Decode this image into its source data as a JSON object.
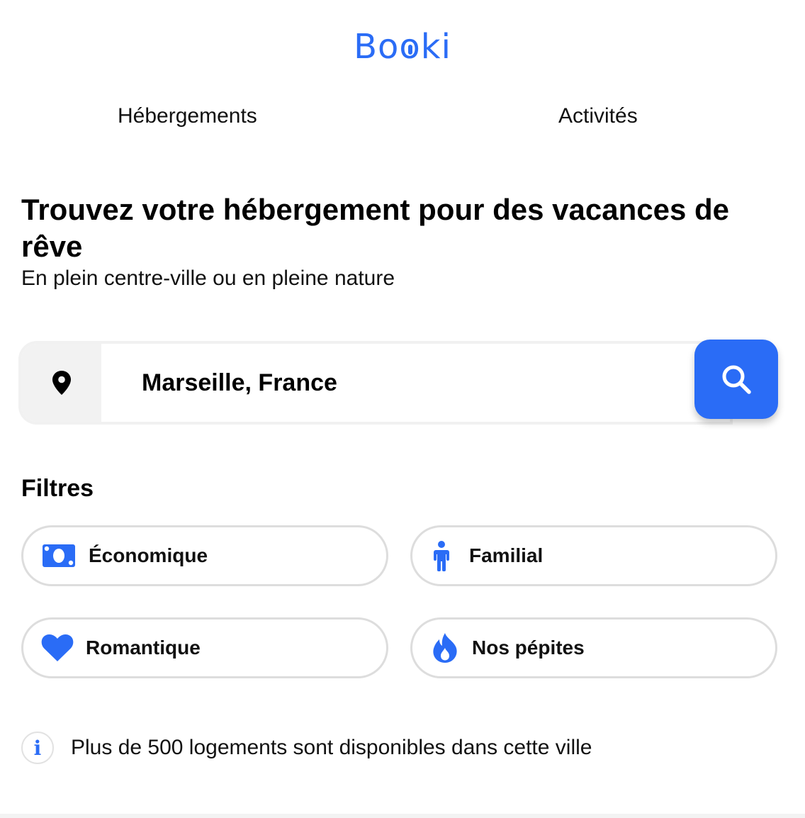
{
  "brand": {
    "logo_prefix": "Bo",
    "logo_suffix": "ki",
    "color": "#2a6cf6"
  },
  "nav": {
    "items": [
      {
        "label": "Hébergements"
      },
      {
        "label": "Activités"
      }
    ]
  },
  "hero": {
    "title": "Trouvez votre hébergement pour des vacances de rêve",
    "subtitle": "En plein centre-ville ou en pleine nature"
  },
  "search": {
    "location_icon": "map-pin-icon",
    "value": "Marseille, France",
    "button_icon": "search-icon"
  },
  "filters": {
    "title": "Filtres",
    "items": [
      {
        "label": "Économique",
        "icon": "money-icon"
      },
      {
        "label": "Familial",
        "icon": "person-icon"
      },
      {
        "label": "Romantique",
        "icon": "heart-icon"
      },
      {
        "label": "Nos pépites",
        "icon": "fire-icon"
      }
    ]
  },
  "info": {
    "icon": "info-icon",
    "icon_glyph": "i",
    "text": "Plus de 500 logements sont disponibles dans cette ville"
  }
}
